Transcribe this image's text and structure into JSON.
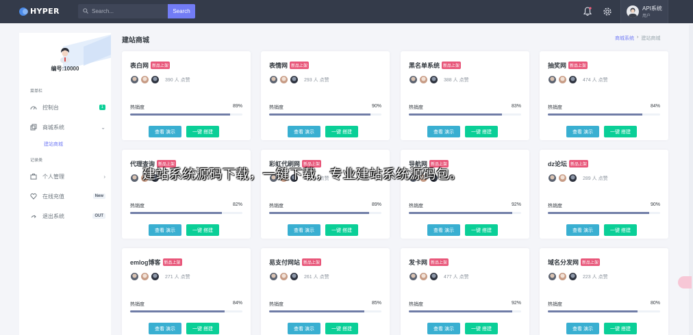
{
  "brand": {
    "name": "HYPER"
  },
  "search": {
    "placeholder": "Search...",
    "button": "Search"
  },
  "user": {
    "name": "API系统",
    "role": "用户"
  },
  "sidebar": {
    "member_no": "编号:10000",
    "sections": [
      {
        "title": "菜单栏"
      },
      {
        "title": "记录类"
      }
    ],
    "items": [
      {
        "label": "控制台",
        "icon": "dashboard-icon",
        "badge": "1"
      },
      {
        "label": "商城系统",
        "icon": "shop-icon"
      },
      {
        "label": "个人管理",
        "icon": "briefcase-icon"
      },
      {
        "label": "在线充值",
        "icon": "heart-icon",
        "badge": "New"
      },
      {
        "label": "退出系统",
        "icon": "logout-icon",
        "badge": "OUT"
      }
    ],
    "sub_items": [
      {
        "label": "建站商城"
      }
    ]
  },
  "page": {
    "title": "建站商城",
    "breadcrumb": [
      "商城系统",
      "建站商城"
    ]
  },
  "common": {
    "tag": "新品上架",
    "hot_label": "热销度",
    "demo_button": "查看 演示",
    "build_button": "一键 搭建"
  },
  "colors": {
    "topbar": "#343b4a",
    "primary": "#727cf5",
    "info": "#39afd1",
    "success": "#0acf97",
    "tag": "#e8577a"
  },
  "cards": [
    {
      "title": "表白网",
      "likes": "390 人 点赞",
      "hot": 89,
      "hot_text": "89%"
    },
    {
      "title": "表情网",
      "likes": "293 人 点赞",
      "hot": 90,
      "hot_text": "90%"
    },
    {
      "title": "黑名单系统",
      "likes": "388 人 点赞",
      "hot": 83,
      "hot_text": "83%"
    },
    {
      "title": "抽奖网",
      "likes": "474 人 点赞",
      "hot": 84,
      "hot_text": "84%"
    },
    {
      "title": "代理查询",
      "likes": "",
      "hot": 82,
      "hot_text": "82%"
    },
    {
      "title": "彩虹代刷网",
      "likes": "315 人 点赞",
      "hot": 89,
      "hot_text": "89%"
    },
    {
      "title": "导航网",
      "likes": "",
      "hot": 92,
      "hot_text": "92%"
    },
    {
      "title": "dz论坛",
      "likes": "289 人 点赞",
      "hot": 90,
      "hot_text": "90%"
    },
    {
      "title": "emlog博客",
      "likes": "271 人 点赞",
      "hot": 84,
      "hot_text": "84%"
    },
    {
      "title": "易支付网站",
      "likes": "261 人 点赞",
      "hot": 85,
      "hot_text": "85%"
    },
    {
      "title": "发卡网",
      "likes": "477 人 点赞",
      "hot": 92,
      "hot_text": "92%"
    },
    {
      "title": "域名分发网",
      "likes": "223 人 点赞",
      "hot": 80,
      "hot_text": "80%"
    }
  ],
  "overlay": {
    "text": "建站系统源码下载，一键下载，专业建站系统源码包。"
  }
}
